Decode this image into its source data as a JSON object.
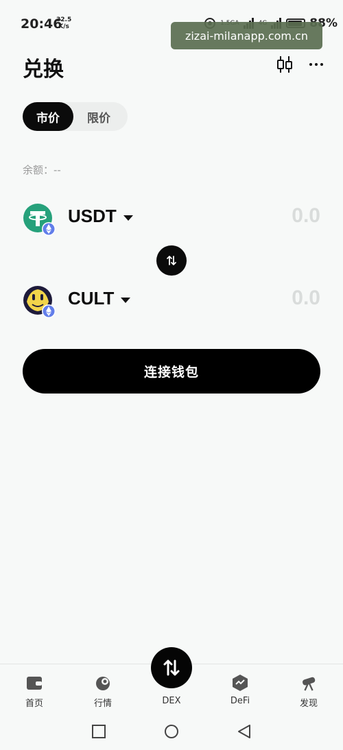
{
  "status_bar": {
    "time": "20:46",
    "speed_value": "32.5",
    "speed_unit": "K/s",
    "net_label_1": "1.5GA",
    "net_label_2": "4G",
    "battery_level": 0.88,
    "battery_pct": "88%"
  },
  "watermark": "zizai-milanapp.com.cn",
  "header": {
    "title": "兑换"
  },
  "tabs": [
    {
      "label": "市价",
      "active": true
    },
    {
      "label": "限价",
      "active": false
    }
  ],
  "balance": {
    "label": "余额：",
    "value": "--"
  },
  "from_token": {
    "symbol": "USDT",
    "amount": "0.0",
    "icon": "tether-icon",
    "chain_badge": "ethereum-icon",
    "color": "#26a17b"
  },
  "to_token": {
    "symbol": "CULT",
    "amount": "0.0",
    "icon": "cult-icon",
    "chain_badge": "ethereum-icon"
  },
  "connect_button": "连接钱包",
  "bottom_nav": [
    {
      "label": "首页",
      "icon": "wallet-icon"
    },
    {
      "label": "行情",
      "icon": "market-icon"
    },
    {
      "label": "DEX",
      "icon": "swap-arrows-icon"
    },
    {
      "label": "DeFi",
      "icon": "defi-icon"
    },
    {
      "label": "发现",
      "icon": "telescope-icon"
    }
  ],
  "colors": {
    "background": "#f7f9f8",
    "primary": "#000000",
    "muted_amount": "#d9dcdb",
    "eth_badge": "#627eea"
  }
}
